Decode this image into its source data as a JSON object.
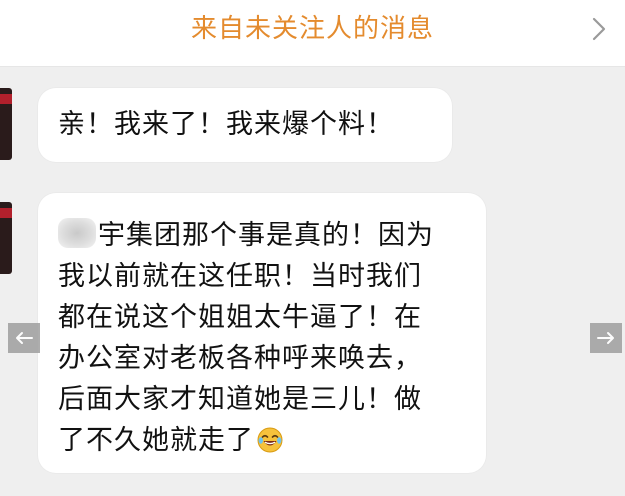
{
  "header": {
    "title": "来自未关注人的消息",
    "chevron_icon": "chevron-right-icon",
    "title_color": "#e48b2e"
  },
  "messages": [
    {
      "text": "亲！我来了！我来爆个料！"
    },
    {
      "lines": [
        "宇集团那个事是真的！因为",
        "我以前就在这任职！当时我们",
        "都在说这个姐姐太牛逼了！在",
        "办公室对老板各种呼来唤去，",
        "后面大家才知道她是三儿！做",
        "了不久她就走了"
      ],
      "redacted_prefix_icon": "blurred-text-redaction",
      "trailing_emoji_icon": "laughing-crying-emoji-icon"
    }
  ],
  "nav": {
    "left_icon": "arrow-left-icon",
    "right_icon": "arrow-right-icon"
  }
}
